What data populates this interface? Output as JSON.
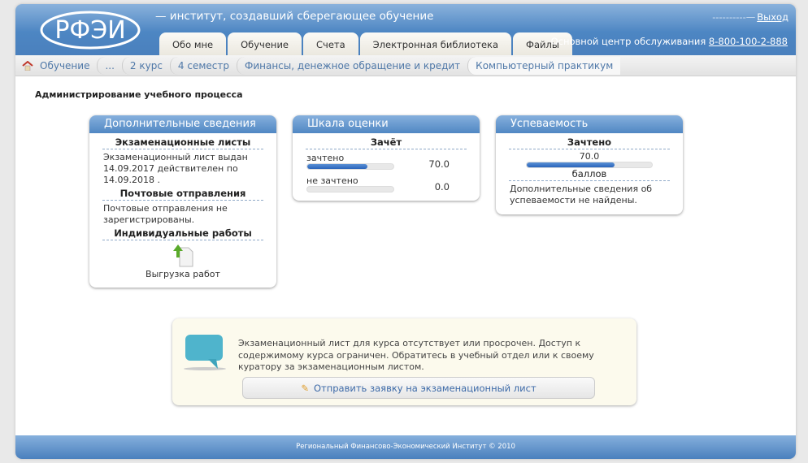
{
  "header": {
    "logo_text": "РФЭИ",
    "slogan": "— институт, создавший сберегающее обучение",
    "user_dash": "----------—",
    "logout": "Выход",
    "service_label": "Основной центр обслуживания",
    "phone": "8-800-100-2-888"
  },
  "tabs": [
    "Обо мне",
    "Обучение",
    "Счета",
    "Электронная библиотека",
    "Файлы"
  ],
  "breadcrumb": [
    "Обучение",
    "...",
    "2 курс",
    "4 семестр",
    "Финансы, денежное обращение и кредит",
    "Компьютерный практикум"
  ],
  "page_title": "Администрирование учебного процесса",
  "info_panel": {
    "title": "Дополнительные сведения",
    "exam_heading": "Экзаменационные листы",
    "exam_text": "Экзаменационный лист выдан 14.09.2017 действителен по 14.09.2018 .",
    "mail_heading": "Почтовые отправления",
    "mail_text": "Почтовые отправления не зарегистрированы.",
    "works_heading": "Индивидуальные работы",
    "upload_label": "Выгрузка работ"
  },
  "scale_panel": {
    "title": "Шкала оценки",
    "heading": "Зачёт",
    "rows": [
      {
        "label": "зачтено",
        "value": "70.0",
        "percent": 70
      },
      {
        "label": "не зачтено",
        "value": "0.0",
        "percent": 0
      }
    ]
  },
  "progress_panel": {
    "title": "Успеваемость",
    "heading": "Зачтено",
    "value": "70.0",
    "percent": 70,
    "unit": "баллов",
    "note": "Дополнительные сведения об успеваемости не найдены."
  },
  "notice": {
    "text": "Экзаменационный лист для курса отсутствует или просрочен. Доступ к содержимому курса ограничен. Обратитесь в учебный отдел или к своему куратору за экзаменационным листом.",
    "button": "Отправить заявку на экзаменационный лист"
  },
  "footer": "Региональный Финансово-Экономический Институт © 2010"
}
